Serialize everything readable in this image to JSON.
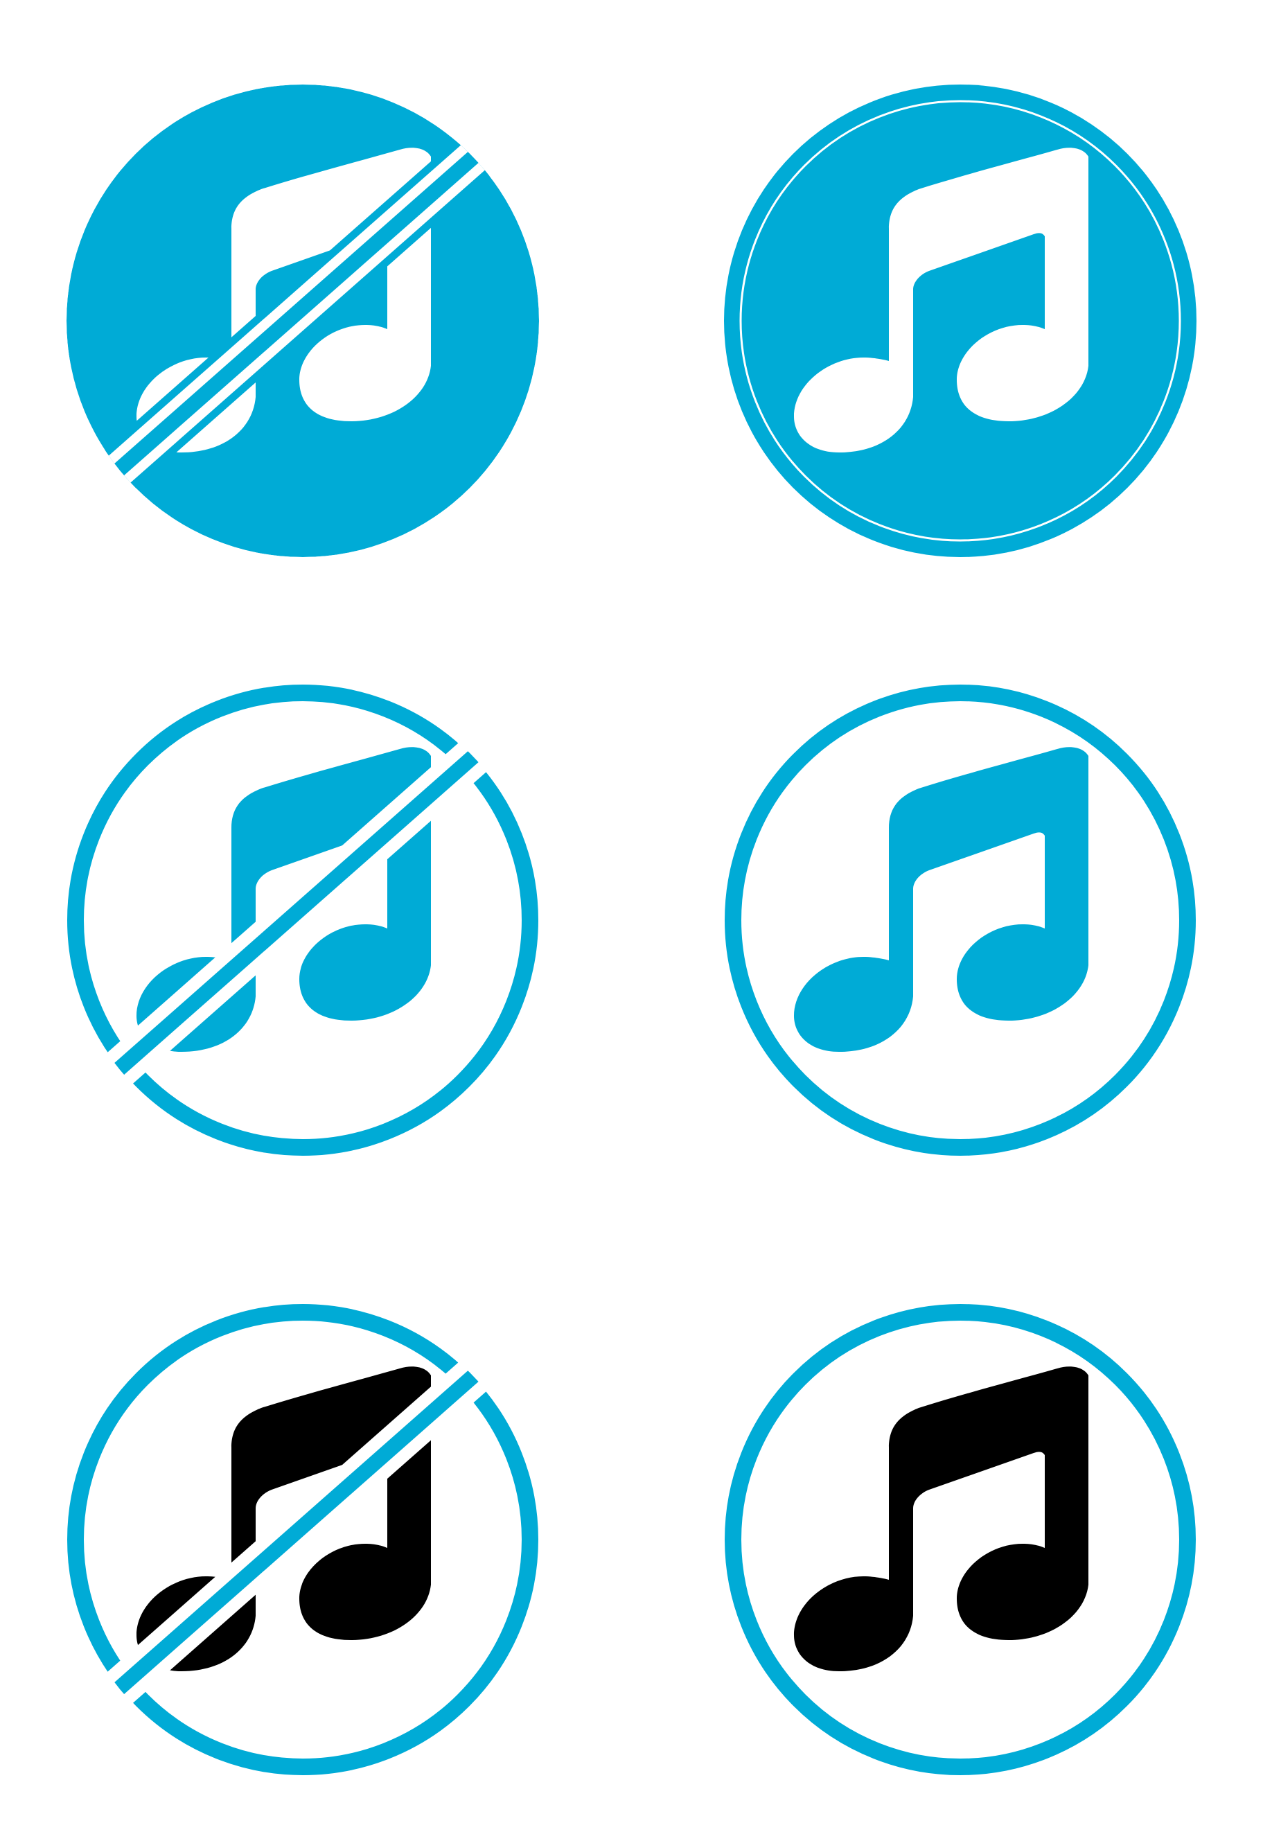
{
  "colors": {
    "accent": "#00abd6",
    "white": "#ffffff",
    "black": "#000000",
    "background": "#ffffff"
  },
  "icons": [
    {
      "name": "music-off-icon",
      "style": "filled",
      "note_color": "white"
    },
    {
      "name": "music-note-icon",
      "style": "filled-with-inner-ring",
      "note_color": "white"
    },
    {
      "name": "music-off-icon",
      "style": "outline",
      "note_color": "accent"
    },
    {
      "name": "music-note-icon",
      "style": "outline",
      "note_color": "accent"
    },
    {
      "name": "music-off-icon",
      "style": "outline",
      "note_color": "black"
    },
    {
      "name": "music-note-icon",
      "style": "outline",
      "note_color": "black"
    }
  ]
}
